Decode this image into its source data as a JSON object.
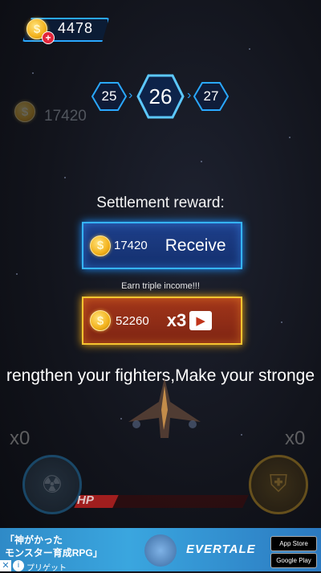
{
  "hud": {
    "coins": "4478",
    "plus": "+"
  },
  "levels": {
    "prev": "25",
    "current": "26",
    "next": "27"
  },
  "earned_faded": "17420",
  "settlement": {
    "title": "Settlement reward:",
    "receive_amount": "17420",
    "receive_label": "Receive",
    "triple_caption": "Earn triple income!!!",
    "triple_amount": "52260",
    "triple_multiplier": "x3"
  },
  "tip_text": "rengthen your fighters,Make your stronge",
  "controls": {
    "bomb_count": "x0",
    "shield_count": "x0",
    "hp_label": "HP"
  },
  "ad": {
    "line1": "「神がかった",
    "line2": "モンスター育成RPG」",
    "logo": "EVERTALE",
    "app_store": "App Store",
    "google_play": "Google Play",
    "disclaimer": "プリゲット"
  },
  "colors": {
    "accent_blue": "#2aa8ff",
    "accent_gold": "#f6c430",
    "reward_red": "#8e2b16"
  }
}
